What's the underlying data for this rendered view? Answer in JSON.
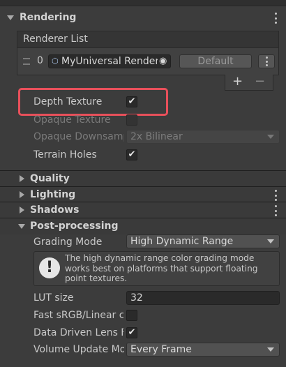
{
  "rendering": {
    "title": "Rendering",
    "renderer_list": {
      "header": "Renderer List",
      "items": [
        {
          "index": "0",
          "asset_name": "MyUniversal Renderer",
          "default_button": "Default"
        }
      ],
      "add_label": "+",
      "remove_label": "−"
    },
    "depth_texture": {
      "label": "Depth Texture",
      "checked": true
    },
    "opaque_texture": {
      "label": "Opaque Texture",
      "checked": false
    },
    "opaque_downsampling": {
      "label": "Opaque Downsampling",
      "value": "2x Bilinear"
    },
    "terrain_holes": {
      "label": "Terrain Holes",
      "checked": true
    },
    "highlight_color": "#e8505b"
  },
  "sections": {
    "quality": "Quality",
    "lighting": "Lighting",
    "shadows": "Shadows",
    "post_processing": "Post-processing"
  },
  "post_processing": {
    "grading_mode": {
      "label": "Grading Mode",
      "value": "High Dynamic Range"
    },
    "help_box": {
      "icon": "warning-icon",
      "text": "The high dynamic range color grading mode works best on platforms that support floating point textures."
    },
    "lut_size": {
      "label": "LUT size",
      "value": "32"
    },
    "fast_srgb": {
      "label": "Fast sRGB/Linear conversions",
      "checked": false
    },
    "data_driven_lens_flare": {
      "label": "Data Driven Lens Flare",
      "checked": true
    },
    "volume_update_mode": {
      "label": "Volume Update Mode",
      "value": "Every Frame"
    }
  },
  "icons": {
    "check": "✔",
    "exclaim": "!",
    "target": "◉"
  }
}
